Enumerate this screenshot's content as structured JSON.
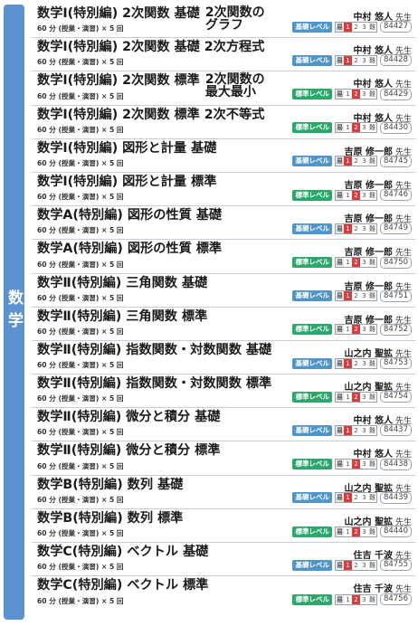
{
  "sidebar": {
    "label": "数学"
  },
  "colors": {
    "basic_badge": "#4f95c9",
    "standard_badge": "#2aa86b",
    "sidebar": "#5b92cf"
  },
  "courses": [
    {
      "title": "数学Ⅰ(特別編) 2次関数 基礎",
      "tail": "2次関数の\nグラフ",
      "sub": "60 分 (授業・演習) × 5 回",
      "teacher": "中村 悠人",
      "sensei": "先生",
      "level": "基礎レベル",
      "level_type": "basic",
      "diff": [
        "易",
        "1",
        "2",
        "3",
        "難"
      ],
      "code": "84427"
    },
    {
      "title": "数学Ⅰ(特別編) 2次関数 基礎 2次方程式",
      "tail": "",
      "sub": "60 分 (授業・演習) × 5 回",
      "teacher": "中村 悠人",
      "sensei": "先生",
      "level": "基礎レベル",
      "level_type": "basic",
      "diff": [
        "易",
        "1",
        "2",
        "3",
        "難"
      ],
      "code": "84428"
    },
    {
      "title": "数学Ⅰ(特別編) 2次関数 標準",
      "tail": "2次関数の\n最大最小",
      "sub": "60 分 (授業・演習) × 5 回",
      "teacher": "中村 悠人",
      "sensei": "先生",
      "level": "標準レベル",
      "level_type": "standard",
      "diff": [
        "易",
        "1",
        "2",
        "3",
        "難"
      ],
      "code": "84429"
    },
    {
      "title": "数学Ⅰ(特別編) 2次関数 標準 2次不等式",
      "tail": "",
      "sub": "60 分 (授業・演習) × 5 回",
      "teacher": "中村 悠人",
      "sensei": "先生",
      "level": "標準レベル",
      "level_type": "standard",
      "diff": [
        "易",
        "1",
        "2",
        "3",
        "難"
      ],
      "code": "84430"
    },
    {
      "title": "数学Ⅰ(特別編) 図形と計量 基礎",
      "tail": "",
      "sub": "60 分 (授業・演習) × 5 回",
      "teacher": "吉原 修一郎",
      "sensei": "先生",
      "level": "基礎レベル",
      "level_type": "basic",
      "diff": [
        "易",
        "1",
        "2",
        "3",
        "難"
      ],
      "code": "84745"
    },
    {
      "title": "数学Ⅰ(特別編) 図形と計量 標準",
      "tail": "",
      "sub": "60 分 (授業・演習) × 5 回",
      "teacher": "吉原 修一郎",
      "sensei": "先生",
      "level": "標準レベル",
      "level_type": "standard",
      "diff": [
        "易",
        "1",
        "2",
        "3",
        "難"
      ],
      "code": "84746"
    },
    {
      "title": "数学A(特別編) 図形の性質 基礎",
      "tail": "",
      "sub": "60 分 (授業・演習) × 5 回",
      "teacher": "吉原 修一郎",
      "sensei": "先生",
      "level": "基礎レベル",
      "level_type": "basic",
      "diff": [
        "易",
        "1",
        "2",
        "3",
        "難"
      ],
      "code": "84749"
    },
    {
      "title": "数学A(特別編) 図形の性質 標準",
      "tail": "",
      "sub": "60 分 (授業・演習) × 5 回",
      "teacher": "吉原 修一郎",
      "sensei": "先生",
      "level": "標準レベル",
      "level_type": "standard",
      "diff": [
        "易",
        "1",
        "2",
        "3",
        "難"
      ],
      "code": "84750"
    },
    {
      "title": "数学Ⅱ(特別編) 三角関数 基礎",
      "tail": "",
      "sub": "60 分 (授業・演習) × 5 回",
      "teacher": "吉原 修一郎",
      "sensei": "先生",
      "level": "基礎レベル",
      "level_type": "basic",
      "diff": [
        "易",
        "1",
        "2",
        "3",
        "難"
      ],
      "code": "84751"
    },
    {
      "title": "数学Ⅱ(特別編) 三角関数 標準",
      "tail": "",
      "sub": "60 分 (授業・演習) × 5 回",
      "teacher": "吉原 修一郎",
      "sensei": "先生",
      "level": "標準レベル",
      "level_type": "standard",
      "diff": [
        "易",
        "1",
        "2",
        "3",
        "難"
      ],
      "code": "84752"
    },
    {
      "title": "数学Ⅱ(特別編) 指数関数・対数関数 基礎",
      "tail": "",
      "sub": "60 分 (授業・演習) × 5 回",
      "teacher": "山之内 聖拡",
      "sensei": "先生",
      "level": "基礎レベル",
      "level_type": "basic",
      "diff": [
        "易",
        "1",
        "2",
        "3",
        "難"
      ],
      "code": "84753"
    },
    {
      "title": "数学Ⅱ(特別編) 指数関数・対数関数 標準",
      "tail": "",
      "sub": "60 分 (授業・演習) × 5 回",
      "teacher": "山之内 聖拡",
      "sensei": "先生",
      "level": "標準レベル",
      "level_type": "standard",
      "diff": [
        "易",
        "1",
        "2",
        "3",
        "難"
      ],
      "code": "84754"
    },
    {
      "title": "数学Ⅱ(特別編) 微分と積分 基礎",
      "tail": "",
      "sub": "60 分 (授業・演習) × 5 回",
      "teacher": "中村 悠人",
      "sensei": "先生",
      "level": "基礎レベル",
      "level_type": "basic",
      "diff": [
        "易",
        "1",
        "2",
        "3",
        "難"
      ],
      "code": "84437"
    },
    {
      "title": "数学Ⅱ(特別編) 微分と積分 標準",
      "tail": "",
      "sub": "60 分 (授業・演習) × 5 回",
      "teacher": "中村 悠人",
      "sensei": "先生",
      "level": "標準レベル",
      "level_type": "standard",
      "diff": [
        "易",
        "1",
        "2",
        "3",
        "難"
      ],
      "code": "84438"
    },
    {
      "title": "数学B(特別編) 数列 基礎",
      "tail": "",
      "sub": "60 分 (授業・演習) × 5 回",
      "teacher": "山之内 聖拡",
      "sensei": "先生",
      "level": "基礎レベル",
      "level_type": "basic",
      "diff": [
        "易",
        "1",
        "2",
        "3",
        "難"
      ],
      "code": "84439"
    },
    {
      "title": "数学B(特別編) 数列 標準",
      "tail": "",
      "sub": "60 分 (授業・演習) × 5 回",
      "teacher": "山之内 聖拡",
      "sensei": "先生",
      "level": "標準レベル",
      "level_type": "standard",
      "diff": [
        "易",
        "1",
        "2",
        "3",
        "難"
      ],
      "code": "84440"
    },
    {
      "title": "数学C(特別編) ベクトル 基礎",
      "tail": "",
      "sub": "60 分 (授業・演習) × 5 回",
      "teacher": "住吉 千波",
      "sensei": "先生",
      "level": "基礎レベル",
      "level_type": "basic",
      "diff": [
        "易",
        "1",
        "2",
        "3",
        "難"
      ],
      "code": "84755"
    },
    {
      "title": "数学C(特別編) ベクトル 標準",
      "tail": "",
      "sub": "60 分 (授業・演習) × 5 回",
      "teacher": "住吉 千波",
      "sensei": "先生",
      "level": "標準レベル",
      "level_type": "standard",
      "diff": [
        "易",
        "1",
        "2",
        "3",
        "難"
      ],
      "code": "84756"
    }
  ]
}
